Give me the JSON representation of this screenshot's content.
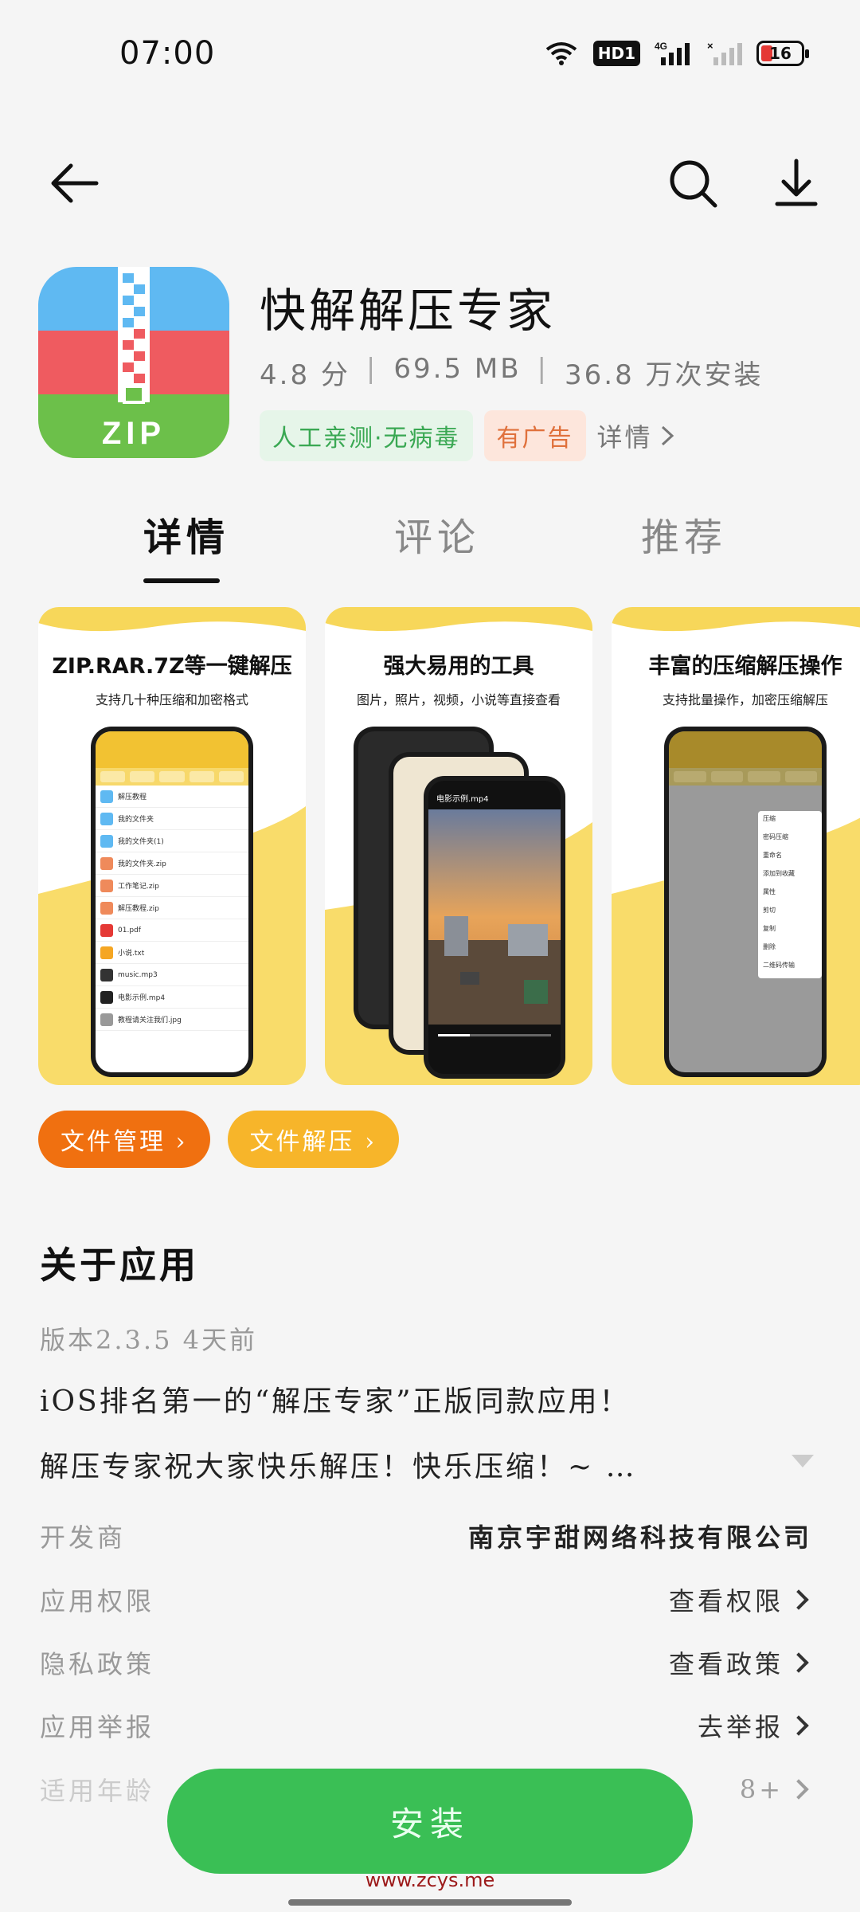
{
  "status_bar": {
    "time": "07:00",
    "hd_label": "HD1",
    "network_label": "4G",
    "battery": "16",
    "icons": [
      "wifi-icon",
      "hd-icon",
      "signal-4g-icon",
      "signal-icon",
      "battery-icon"
    ]
  },
  "nav": {
    "icons": [
      "back-arrow-icon",
      "search-icon",
      "download-icon"
    ]
  },
  "app": {
    "name": "快解解压专家",
    "rating": "4.8 分",
    "size": "69.5 MB",
    "installs": "36.8 万次安装",
    "badge_safe": "人工亲测·无病毒",
    "badge_ad": "有广告",
    "details_link": "详情"
  },
  "tabs": [
    {
      "label": "详情",
      "active": true
    },
    {
      "label": "评论",
      "active": false
    },
    {
      "label": "推荐",
      "active": false
    }
  ],
  "screenshots": [
    {
      "title": "ZIP.RAR.7Z等一键解压",
      "subtitle": "支持几十种压缩和加密格式",
      "files": [
        "解压教程",
        "我的文件夹",
        "我的文件夹(1)",
        "我的文件夹.zip",
        "工作笔记.zip",
        "解压教程.zip",
        "01.pdf",
        "小说.txt",
        "music.mp3",
        "电影示例.mp4",
        "教程请关注我们.jpg"
      ]
    },
    {
      "title": "强大易用的工具",
      "subtitle": "图片，照片，视频，小说等直接查看",
      "video_title": "电影示例.mp4"
    },
    {
      "title": "丰富的压缩解压操作",
      "subtitle": "支持批量操作，加密压缩解压",
      "menu": [
        "压缩",
        "密码压缩",
        "重命名",
        "添加到收藏",
        "属性",
        "剪切",
        "复制",
        "删除",
        "二维码传输"
      ]
    }
  ],
  "pills": [
    {
      "label": "文件管理 ›"
    },
    {
      "label": "文件解压 ›"
    }
  ],
  "about": {
    "title": "关于应用",
    "version": "版本2.3.5  4天前",
    "desc_line1": "iOS排名第一的“解压专家”正版同款应用！",
    "desc_line2": "解压专家祝大家快乐解压！快乐压缩！~ …"
  },
  "info_rows": [
    {
      "key": "开发商",
      "value": "南京宇甜网络科技有限公司"
    },
    {
      "key": "应用权限",
      "value": "查看权限"
    },
    {
      "key": "隐私政策",
      "value": "查看政策"
    },
    {
      "key": "应用举报",
      "value": "去举报"
    },
    {
      "key": "适用年龄",
      "value": "8+"
    }
  ],
  "install_button": "安装",
  "watermark": "www.zcys.me",
  "colors": {
    "install_green": "#3abf55",
    "pill_orange": "#f07010",
    "pill_yellow": "#f7b52a",
    "badge_green": "#3aa853",
    "badge_orange": "#e0713c"
  }
}
